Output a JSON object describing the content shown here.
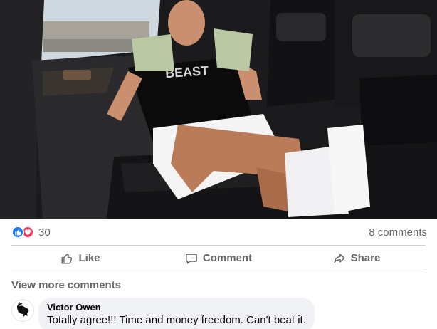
{
  "post": {
    "photo": {
      "shirt_text": "BEAST"
    },
    "reactions": {
      "types": [
        "like-icon",
        "love-icon"
      ],
      "count": "30"
    },
    "comments_count_label": "8 comments",
    "actions": {
      "like_label": "Like",
      "comment_label": "Comment",
      "share_label": "Share"
    },
    "view_more_label": "View more comments",
    "comments": [
      {
        "author": "Victor Owen",
        "text": "Totally agree!!! Time and money freedom. Can't beat it."
      }
    ]
  },
  "colors": {
    "like_blue": "#1877f2",
    "love_red": "#f33e58",
    "secondary_text": "#65676b",
    "bubble_bg": "#f0f2f5"
  }
}
